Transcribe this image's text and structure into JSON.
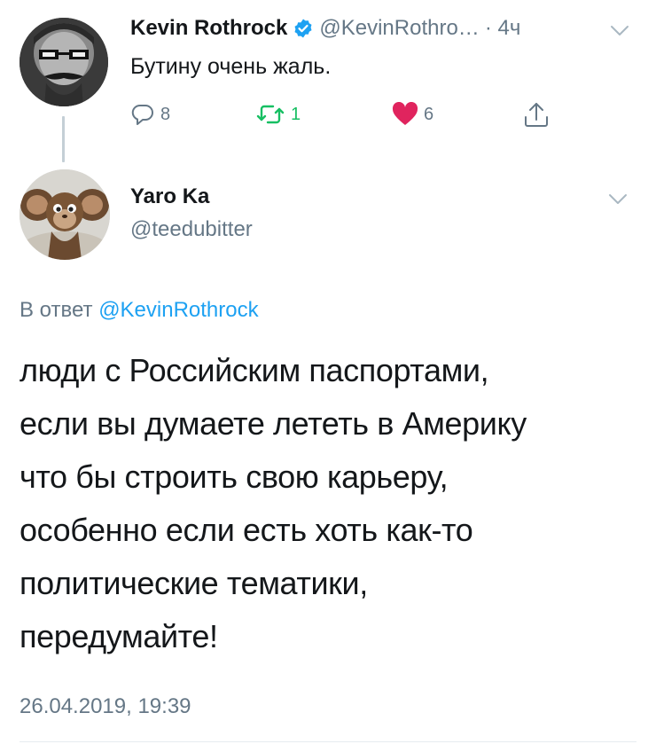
{
  "parent_tweet": {
    "author_name": "Kevin Rothrock",
    "author_handle": "@KevinRothro…",
    "time": "· 4ч",
    "text": "Бутину очень жаль.",
    "actions": {
      "replies": "8",
      "retweets": "1",
      "likes": "6"
    },
    "verified": true,
    "like_color": "#e0245e",
    "retweet_color": "#17bf63"
  },
  "reply_tweet": {
    "author_name": "Yaro Ka",
    "author_handle": "@teedubitter",
    "in_reply_prefix": "В ответ",
    "in_reply_mention": "@KevinRothrock",
    "lines": [
      "люди с Российским паспортами,",
      "если вы думаете лететь в Америку",
      "что бы строить свою карьеру,",
      "особенно если есть хоть как-то",
      "политические тематики,",
      "передумайте!"
    ],
    "timestamp": "26.04.2019, 19:39"
  },
  "icons": {
    "reply": "reply-icon",
    "retweet": "retweet-icon",
    "like": "heart-icon",
    "share": "share-icon",
    "more": "chevron-down-icon",
    "verified": "verified-badge-icon"
  },
  "colors": {
    "link": "#1da1f2",
    "secondary_text": "#657786",
    "primary_text": "#14171a"
  }
}
